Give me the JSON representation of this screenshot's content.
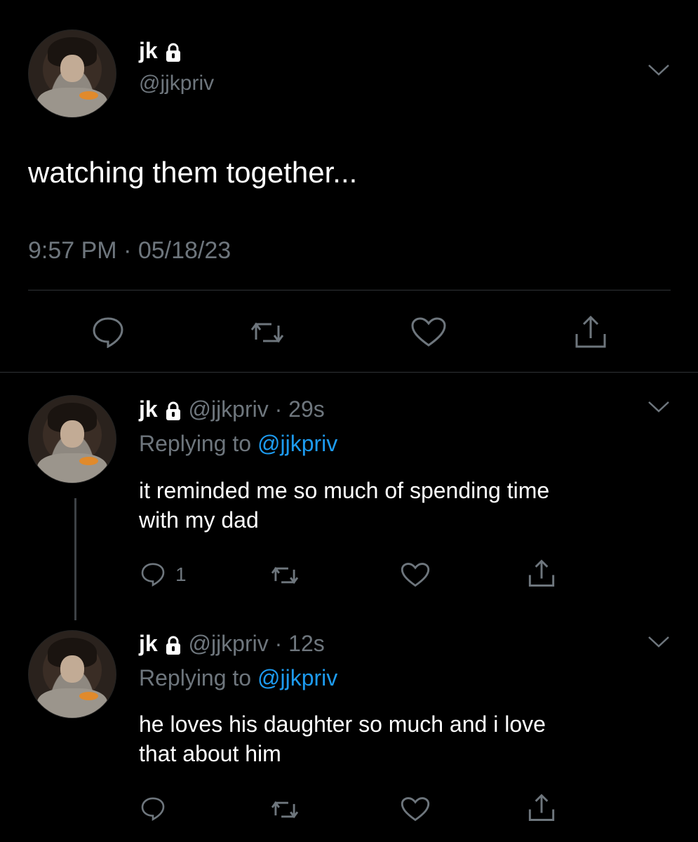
{
  "main_tweet": {
    "display_name": "jk",
    "handle": "@jjkpriv",
    "text": "watching them together...",
    "timestamp": "9:57 PM · 05/18/23",
    "icons": {
      "lock": "lock-icon",
      "menu": "chevron-down-icon",
      "reply": "reply-icon",
      "retweet": "retweet-icon",
      "like": "heart-icon",
      "share": "share-icon"
    }
  },
  "replies": [
    {
      "display_name": "jk",
      "handle_time": "@jjkpriv · 29s",
      "replying_prefix": "Replying to",
      "replying_handle": "@jjkpriv",
      "text_line1": "it reminded me so much of spending time",
      "text_line2": "with my dad",
      "reply_count": "1"
    },
    {
      "display_name": "jk",
      "handle_time": "@jjkpriv · 12s",
      "replying_prefix": "Replying to",
      "replying_handle": "@jjkpriv",
      "text_line1": "he loves his daughter so much and i love",
      "text_line2": "that about him",
      "reply_count": ""
    }
  ],
  "colors": {
    "background": "#000000",
    "text": "#ffffff",
    "muted": "#6e767d",
    "link": "#1d9bf0",
    "divider": "#2f3336"
  }
}
